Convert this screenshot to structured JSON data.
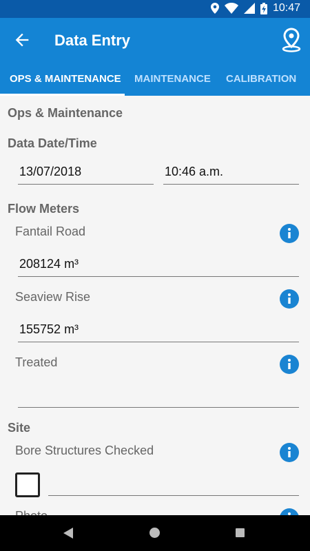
{
  "status": {
    "time": "10:47",
    "icons": [
      "location-icon",
      "wifi-icon",
      "cell-signal-icon",
      "battery-charging-icon"
    ]
  },
  "appbar": {
    "title": "Data Entry",
    "back_icon": "arrow-back-icon",
    "action_icon": "location-pin-icon"
  },
  "tabs": [
    {
      "label": "OPS & MAINTENANCE",
      "active": true
    },
    {
      "label": "MAINTENANCE",
      "active": false
    },
    {
      "label": "CALIBRATION",
      "active": false
    }
  ],
  "form": {
    "section_title": "Ops & Maintenance",
    "datetime_label": "Data Date/Time",
    "date_value": "13/07/2018",
    "time_value": "10:46 a.m.",
    "flow_meters_label": "Flow Meters",
    "fantail_label": "Fantail Road",
    "fantail_value": "208124 m³",
    "seaview_label": "Seaview Rise",
    "seaview_value": "155752 m³",
    "treated_label": "Treated",
    "treated_value": "",
    "site_label": "Site",
    "bore_label": "Bore Structures Checked",
    "bore_checked": false,
    "bore_value": "",
    "photo_label": "Photo"
  },
  "colors": {
    "primary": "#1484d4",
    "status_bar": "#0a5aa8",
    "info": "#1a84d2"
  }
}
